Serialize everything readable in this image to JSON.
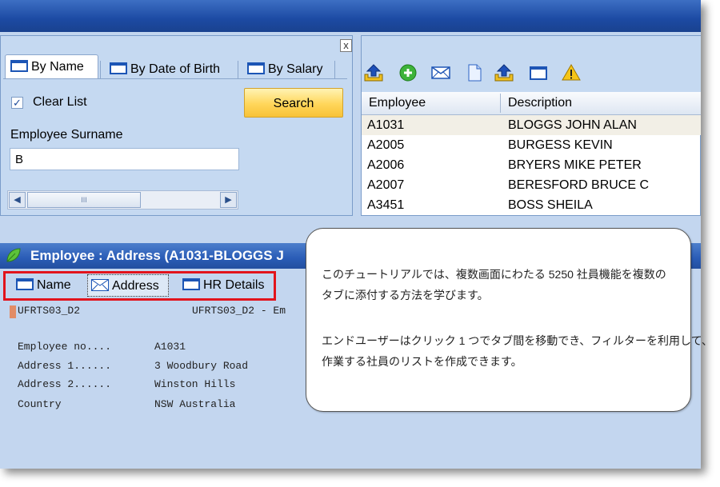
{
  "search_panel": {
    "close_label": "x",
    "tabs": [
      {
        "label": "By Name"
      },
      {
        "label": "By Date of Birth"
      },
      {
        "label": "By Salary"
      }
    ],
    "clear_list_label": "Clear List",
    "clear_list_checked": true,
    "search_button_label": "Search",
    "surname_label": "Employee Surname",
    "surname_value": "B",
    "scroll_thumb_grip": "III"
  },
  "list_panel": {
    "columns": [
      "Employee",
      "Description"
    ],
    "rows": [
      {
        "id": "A1031",
        "description": "BLOGGS JOHN ALAN",
        "selected": true
      },
      {
        "id": "A2005",
        "description": "BURGESS KEVIN"
      },
      {
        "id": "A2006",
        "description": "BRYERS MIKE PETER"
      },
      {
        "id": "A2007",
        "description": "BERESFORD BRUCE C"
      },
      {
        "id": "A3451",
        "description": "BOSS SHEILA"
      }
    ],
    "toolbar_icons": [
      "upload-icon",
      "add-icon",
      "mail-icon",
      "document-icon",
      "upload-icon",
      "window-icon",
      "warning-icon"
    ]
  },
  "detail_panel": {
    "title": "Employee : Address (A1031-BLOGGS J",
    "tabs": [
      {
        "label": "Name"
      },
      {
        "label": "Address",
        "active": true
      },
      {
        "label": "HR Details"
      }
    ],
    "header_left": "UFRTS03_D2",
    "header_right": "UFRTS03_D2 - Em",
    "fields": [
      {
        "label": "Employee no....",
        "value": "A1031"
      },
      {
        "label": "Address 1......",
        "value": "3 Woodbury Road"
      },
      {
        "label": "Address 2......",
        "value": "Winston Hills"
      },
      {
        "label": "Country",
        "value": "NSW Australia"
      }
    ]
  },
  "callout": {
    "line1": "このチュートリアルでは、複数画面にわたる 5250 社員機能を複数の",
    "line2": "タブに添付する方法を学びます。",
    "line3": "エンドユーザーはクリック 1 つでタブ間を移動でき、フィルターを利用して、",
    "line4": "作業する社員のリストを作成できます。"
  },
  "colors": {
    "title_bar": "#2a5cb6",
    "panel_bg": "#c5d9f1",
    "search_button": "#ffd65a",
    "highlight_box": "#e2141c",
    "selected_row": "#f2efe6"
  }
}
